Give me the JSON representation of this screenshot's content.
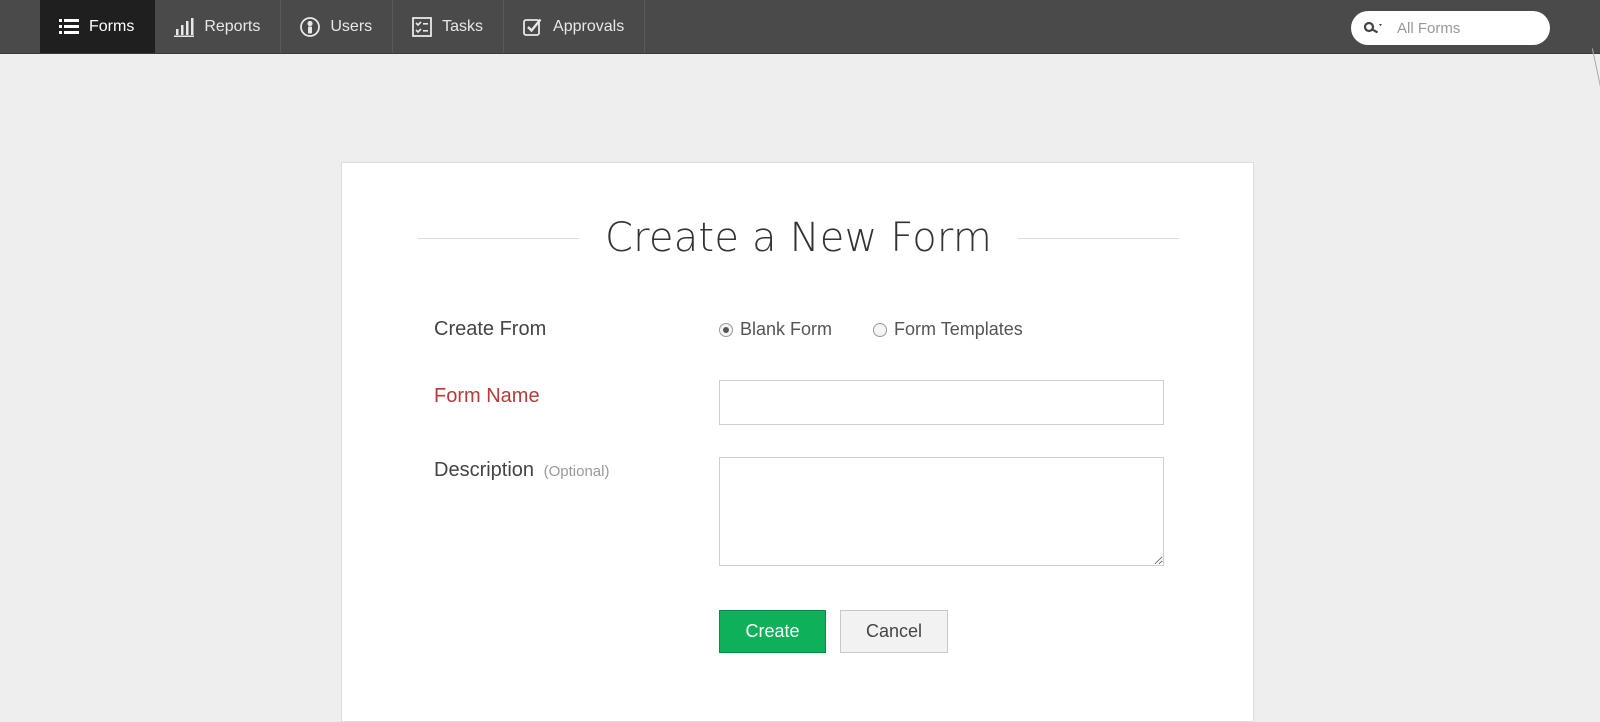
{
  "nav": {
    "items": [
      {
        "label": "Forms",
        "icon": "list-icon",
        "active": true
      },
      {
        "label": "Reports",
        "icon": "bar-chart-icon",
        "active": false
      },
      {
        "label": "Users",
        "icon": "user-circle-icon",
        "active": false
      },
      {
        "label": "Tasks",
        "icon": "checklist-icon",
        "active": false
      },
      {
        "label": "Approvals",
        "icon": "checkbox-check-icon",
        "active": false
      }
    ]
  },
  "search": {
    "placeholder": "All Forms",
    "icon": "search-key-icon"
  },
  "form": {
    "title": "Create a New Form",
    "create_from_label": "Create From",
    "options": [
      {
        "label": "Blank Form",
        "checked": true
      },
      {
        "label": "Form Templates",
        "checked": false
      }
    ],
    "name_label": "Form Name",
    "name_value": "",
    "description_label": "Description",
    "description_optional": "(Optional)",
    "description_value": "",
    "create_button": "Create",
    "cancel_button": "Cancel"
  },
  "colors": {
    "topbar": "#4a4a4a",
    "active_tab": "#1f1f1f",
    "required_label": "#b83b3b",
    "create_button": "#0fb05a"
  }
}
